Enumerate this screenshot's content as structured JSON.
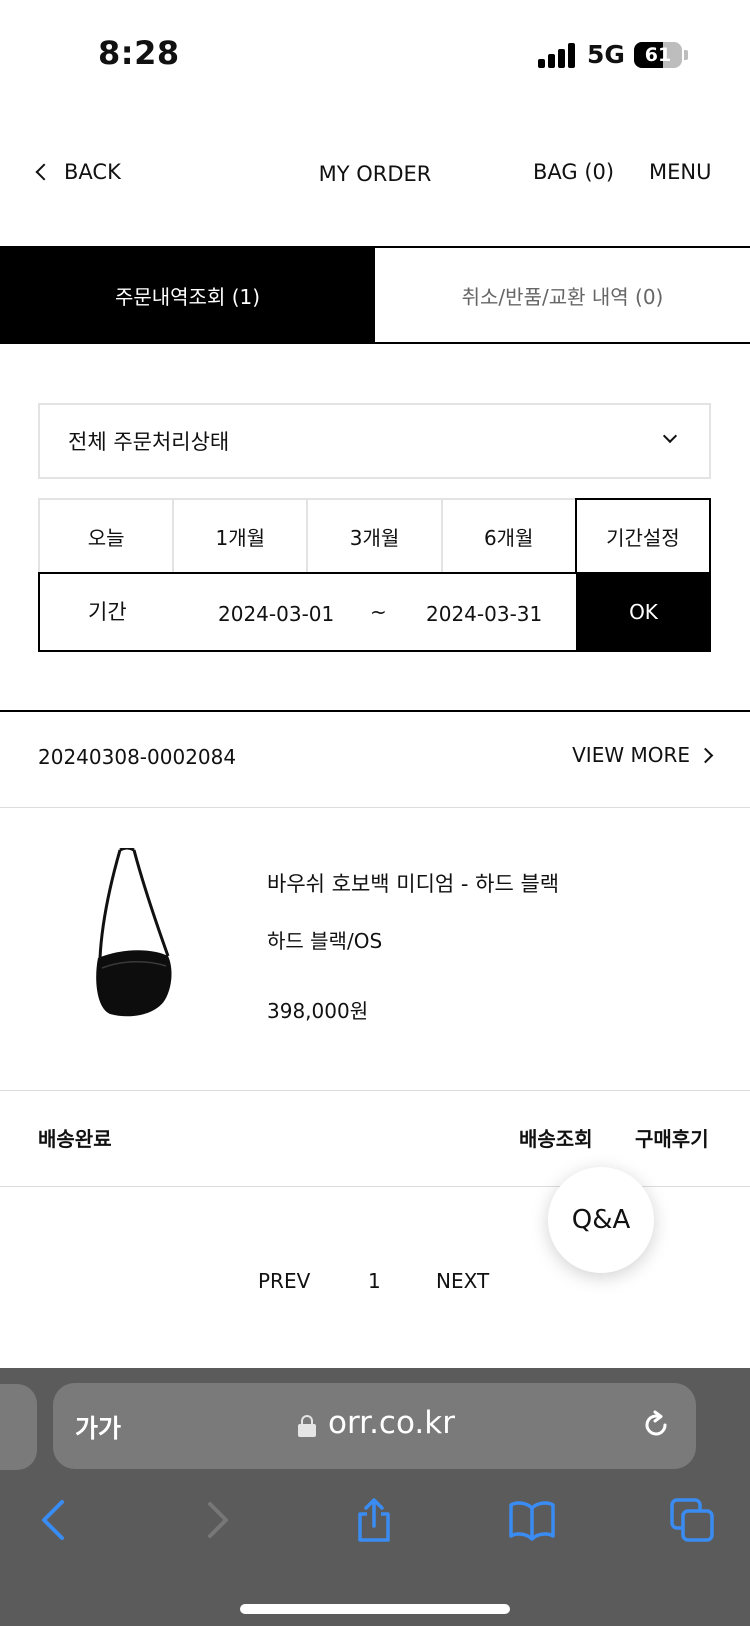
{
  "status_bar": {
    "time": "8:28",
    "network": "5G",
    "battery": "61",
    "battery_level": 0.61
  },
  "header": {
    "back_label": "BACK",
    "title": "MY ORDER",
    "bag_label": "BAG (0)",
    "menu_label": "MENU"
  },
  "tabs": [
    {
      "label": "주문내역조회 (1)",
      "active": true
    },
    {
      "label": "취소/반품/교환 내역 (0)",
      "active": false
    }
  ],
  "filter": {
    "status_select": "전체 주문처리상태",
    "periods": [
      "오늘",
      "1개월",
      "3개월",
      "6개월",
      "기간설정"
    ],
    "selected_period": "기간설정",
    "date_label": "기간",
    "start_date": "2024-03-01",
    "separator": "~",
    "end_date": "2024-03-31",
    "ok_label": "OK"
  },
  "order": {
    "number": "20240308-0002084",
    "view_more_label": "VIEW MORE",
    "product": {
      "name": "바우쉬 호보백 미디엄 - 하드 블랙",
      "option": "하드 블랙/OS",
      "price": "398,000원"
    },
    "delivery_status": "배송완료",
    "track_label": "배송조회",
    "review_label": "구매후기"
  },
  "pagination": {
    "prev_label": "PREV",
    "current_page": "1",
    "next_label": "NEXT"
  },
  "qa_label": "Q&A",
  "browser": {
    "aa_label": "가가",
    "url": "orr.co.kr"
  },
  "colors": {
    "accent_blue": "#3a8cf2",
    "dark": "#000000",
    "chrome": "#5b5b5b"
  }
}
